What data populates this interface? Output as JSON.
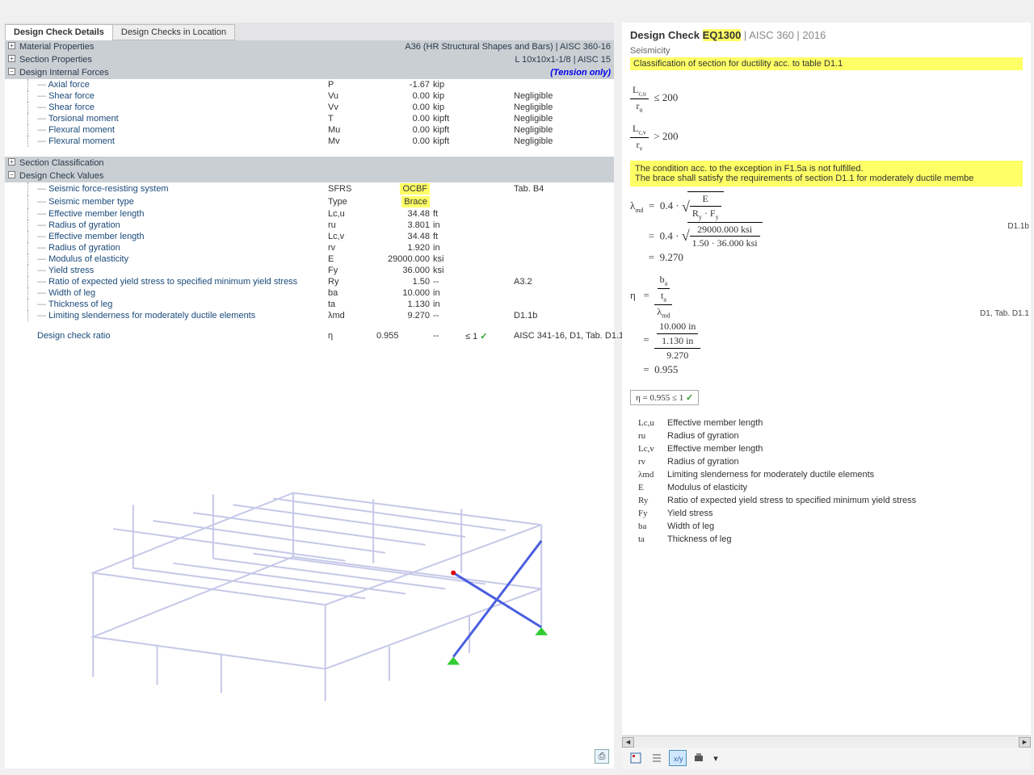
{
  "tabs": {
    "t1": "Design Check Details",
    "t2": "Design Checks in Location"
  },
  "sections": {
    "material": {
      "title": "Material Properties",
      "right": "A36 (HR Structural Shapes and Bars) | AISC 360-16"
    },
    "sectionProps": {
      "title": "Section Properties",
      "right": "L 10x10x1-1/8 | AISC 15"
    },
    "forces": {
      "title": "Design Internal Forces",
      "right": "(Tension only)"
    },
    "classif": {
      "title": "Section Classification"
    },
    "checkValues": {
      "title": "Design Check Values"
    }
  },
  "forces": [
    {
      "name": "Axial force",
      "sym": "P",
      "val": "-1.67",
      "unit": "kip",
      "extra": ""
    },
    {
      "name": "Shear force",
      "sym": "Vu",
      "val": "0.00",
      "unit": "kip",
      "extra": "Negligible"
    },
    {
      "name": "Shear force",
      "sym": "Vv",
      "val": "0.00",
      "unit": "kip",
      "extra": "Negligible"
    },
    {
      "name": "Torsional moment",
      "sym": "T",
      "val": "0.00",
      "unit": "kipft",
      "extra": "Negligible"
    },
    {
      "name": "Flexural moment",
      "sym": "Mu",
      "val": "0.00",
      "unit": "kipft",
      "extra": "Negligible"
    },
    {
      "name": "Flexural moment",
      "sym": "Mv",
      "val": "0.00",
      "unit": "kipft",
      "extra": "Negligible"
    }
  ],
  "checkValues": [
    {
      "name": "Seismic force-resisting system",
      "sym": "SFRS",
      "val": "OCBF",
      "unit": "",
      "extra": "Tab. B4",
      "hl": true
    },
    {
      "name": "Seismic member type",
      "sym": "Type",
      "val": "Brace",
      "unit": "",
      "extra": "",
      "hl": true
    },
    {
      "name": "Effective member length",
      "sym": "Lc,u",
      "val": "34.48",
      "unit": "ft",
      "extra": ""
    },
    {
      "name": "Radius of gyration",
      "sym": "ru",
      "val": "3.801",
      "unit": "in",
      "extra": ""
    },
    {
      "name": "Effective member length",
      "sym": "Lc,v",
      "val": "34.48",
      "unit": "ft",
      "extra": ""
    },
    {
      "name": "Radius of gyration",
      "sym": "rv",
      "val": "1.920",
      "unit": "in",
      "extra": ""
    },
    {
      "name": "Modulus of elasticity",
      "sym": "E",
      "val": "29000.000",
      "unit": "ksi",
      "extra": ""
    },
    {
      "name": "Yield stress",
      "sym": "Fy",
      "val": "36.000",
      "unit": "ksi",
      "extra": ""
    },
    {
      "name": "Ratio of expected yield stress to specified minimum yield stress",
      "sym": "Ry",
      "val": "1.50",
      "unit": "--",
      "extra": "A3.2"
    },
    {
      "name": "Width of leg",
      "sym": "ba",
      "val": "10.000",
      "unit": "in",
      "extra": ""
    },
    {
      "name": "Thickness of leg",
      "sym": "ta",
      "val": "1.130",
      "unit": "in",
      "extra": ""
    },
    {
      "name": "Limiting slenderness for moderately ductile elements",
      "sym": "λmd",
      "val": "9.270",
      "unit": "--",
      "extra": "D1.1b"
    }
  ],
  "finalCheck": {
    "name": "Design check ratio",
    "sym": "η",
    "val": "0.955",
    "unit": "--",
    "cond": "≤ 1",
    "ref": "AISC 341-16, D1, Tab. D1.1"
  },
  "right": {
    "title_pre": "Design Check ",
    "code": "EQ1300",
    "spec": " | AISC 360 | 2016",
    "subtitle": "Seismicity",
    "classif": "Classification of section for ductility acc. to table D1.1",
    "cond1": {
      "lhs_num": "Lc,u",
      "lhs_den": "ru",
      "op": "≤",
      "rhs": "200"
    },
    "cond2": {
      "lhs_num": "Lc,v",
      "lhs_den": "rv",
      "op": ">",
      "rhs": "200"
    },
    "warn1": "The condition acc. to the exception in F1.5a is not fulfilled.",
    "warn2": "The brace shall satisfy the requirements of section D1.1 for moderately ductile membe",
    "lambda": {
      "sym": "λ md",
      "f1_num_E": "E",
      "f1_den": "Ry · Fy",
      "coef": "0.4",
      "num2": "29000.000 ksi",
      "den2": "1.50 · 36.000 ksi",
      "result": "9.270"
    },
    "eta": {
      "sym": "η",
      "num1": "ba",
      "num2": "ta",
      "den": "λ md",
      "numval1": "10.000 in",
      "numval2": "1.130 in",
      "denval": "9.270",
      "result": "0.955"
    },
    "resultLine": "η   =   0.955  ≤ 1",
    "ref1": "D1.1b",
    "ref2": "D1, Tab. D1.1"
  },
  "legend": [
    {
      "sym": "Lc,u",
      "desc": "Effective member length"
    },
    {
      "sym": "ru",
      "desc": "Radius of gyration"
    },
    {
      "sym": "Lc,v",
      "desc": "Effective member length"
    },
    {
      "sym": "rv",
      "desc": "Radius of gyration"
    },
    {
      "sym": "λmd",
      "desc": "Limiting slenderness for moderately ductile elements"
    },
    {
      "sym": "E",
      "desc": "Modulus of elasticity"
    },
    {
      "sym": "Ry",
      "desc": "Ratio of expected yield stress to specified minimum yield stress"
    },
    {
      "sym": "Fy",
      "desc": "Yield stress"
    },
    {
      "sym": "ba",
      "desc": "Width of leg"
    },
    {
      "sym": "ta",
      "desc": "Thickness of leg"
    }
  ]
}
